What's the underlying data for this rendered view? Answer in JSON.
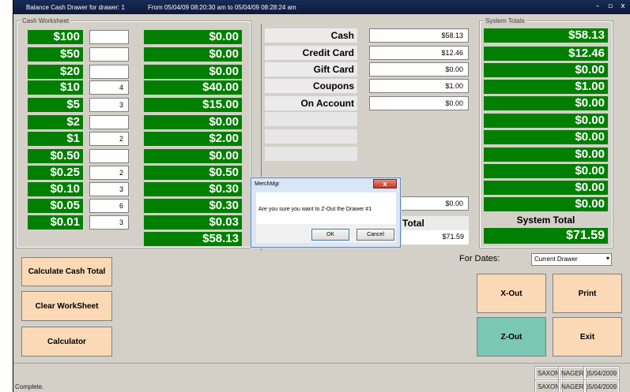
{
  "window": {
    "title": "Balance Cash Drawer for drawer: 1",
    "date_range": "From 05/04/09 08:20:30 am  to  05/04/09 08:28:24 am",
    "minimize": "–",
    "maximize": "▫",
    "close": "x"
  },
  "worksheet": {
    "label": "Cash Worksheet",
    "rows": [
      {
        "denomination": "$100",
        "count": "",
        "amount": "$0.00"
      },
      {
        "denomination": "$50",
        "count": "",
        "amount": "$0.00"
      },
      {
        "denomination": "$20",
        "count": "",
        "amount": "$0.00"
      },
      {
        "denomination": "$10",
        "count": "4",
        "amount": "$40.00"
      },
      {
        "denomination": "$5",
        "count": "3",
        "amount": "$15.00"
      },
      {
        "denomination": "$2",
        "count": "",
        "amount": "$0.00"
      },
      {
        "denomination": "$1",
        "count": "2",
        "amount": "$2.00"
      },
      {
        "denomination": "$0.50",
        "count": "",
        "amount": "$0.00"
      },
      {
        "denomination": "$0.25",
        "count": "2",
        "amount": "$0.50"
      },
      {
        "denomination": "$0.10",
        "count": "3",
        "amount": "$0.30"
      },
      {
        "denomination": "$0.05",
        "count": "6",
        "amount": "$0.30"
      },
      {
        "denomination": "$0.01",
        "count": "3",
        "amount": "$0.03"
      }
    ],
    "total": "$58.13"
  },
  "tenders": {
    "rows": [
      {
        "label": "Cash",
        "value": "$58.13"
      },
      {
        "label": "Credit Card",
        "value": "$12.46"
      },
      {
        "label": "Gift Card",
        "value": "$0.00"
      },
      {
        "label": "Coupons",
        "value": "$1.00"
      },
      {
        "label": "On Account",
        "value": "$0.00"
      }
    ],
    "extra_value": "$0.00",
    "total_label": "Total",
    "total_value": "$71.59"
  },
  "system_totals": {
    "label": "System Totals",
    "values": [
      "$58.13",
      "$12.46",
      "$0.00",
      "$1.00",
      "$0.00",
      "$0.00",
      "$0.00",
      "$0.00",
      "$0.00",
      "$0.00",
      "$0.00"
    ],
    "total_label": "System Total",
    "total_value": "$71.59"
  },
  "buttons": {
    "calc_cash": "Calculate Cash Total",
    "clear": "Clear WorkSheet",
    "calculator": "Calculator",
    "xout": "X-Out",
    "print": "Print",
    "zout": "Z-Out",
    "exit": "Exit"
  },
  "for_dates": {
    "label": "For Dates:",
    "selected": "Current Drawer"
  },
  "status": {
    "message": "Complete.",
    "line1_user": "SAXON",
    "line1_role": "NAGER",
    "line1_date": ")5/04/2009",
    "line2_user": "SAXON",
    "line2_role": "NAGER",
    "line2_date": ")5/04/2009"
  },
  "dialog": {
    "title": "MerchMgr",
    "message": "Are you sure you want to Z-Out the Drawer #1",
    "ok": "OK",
    "cancel": "Cancel",
    "close": "x"
  },
  "colors": {
    "green": "#007f00",
    "button_peach": "#fcd9b6",
    "button_teal": "#79c7b4",
    "title_navy": "#0d1a3a"
  }
}
